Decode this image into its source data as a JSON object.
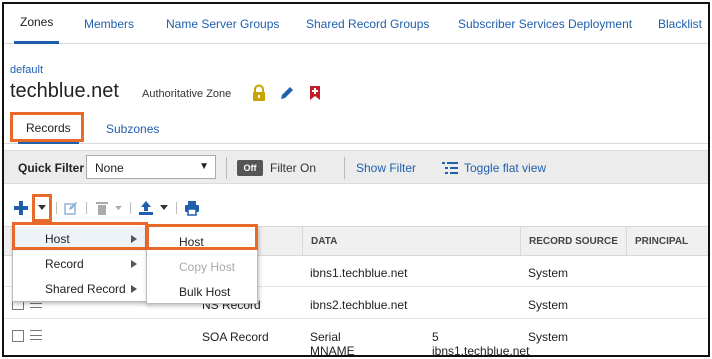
{
  "top_tabs": [
    "Zones",
    "Members",
    "Name Server Groups",
    "Shared Record Groups",
    "Subscriber Services Deployment",
    "Blacklist"
  ],
  "breadcrumb": "default",
  "zone": {
    "name": "techblue.net",
    "type": "Authoritative Zone"
  },
  "sub_tabs": [
    "Records",
    "Subzones"
  ],
  "filter": {
    "label": "Quick Filter",
    "selected": "None",
    "toggle": "Off",
    "filter_on": "Filter On",
    "show_filter": "Show Filter",
    "toggle_flat": "Toggle flat view"
  },
  "toolbar_icons": [
    "add-icon",
    "dropdown-icon",
    "edit-icon",
    "delete-icon",
    "export-icon",
    "print-icon"
  ],
  "columns": [
    "DATA",
    "RECORD SOURCE",
    "PRINCIPAL"
  ],
  "rows": [
    {
      "type": "",
      "data": "ibns1.techblue.net",
      "data2": "",
      "source": "System"
    },
    {
      "type": "NS Record",
      "data": "ibns2.techblue.net",
      "data2": "",
      "source": "System"
    },
    {
      "type": "SOA Record",
      "data": "Serial",
      "data_line2": "MNAME",
      "data2": "5",
      "data2_line2": "ibns1.techblue.net",
      "source": "System"
    }
  ],
  "add_menu": [
    {
      "label": "Host"
    },
    {
      "label": "Record"
    },
    {
      "label": "Shared Record"
    }
  ],
  "host_submenu": [
    {
      "label": "Host",
      "enabled": true
    },
    {
      "label": "Copy Host",
      "enabled": false
    },
    {
      "label": "Bulk Host",
      "enabled": true
    }
  ],
  "colors": {
    "link": "#1f5fae",
    "highlight": "#e8692a",
    "lock": "#c9a400",
    "bookmark": "#c0202a"
  }
}
